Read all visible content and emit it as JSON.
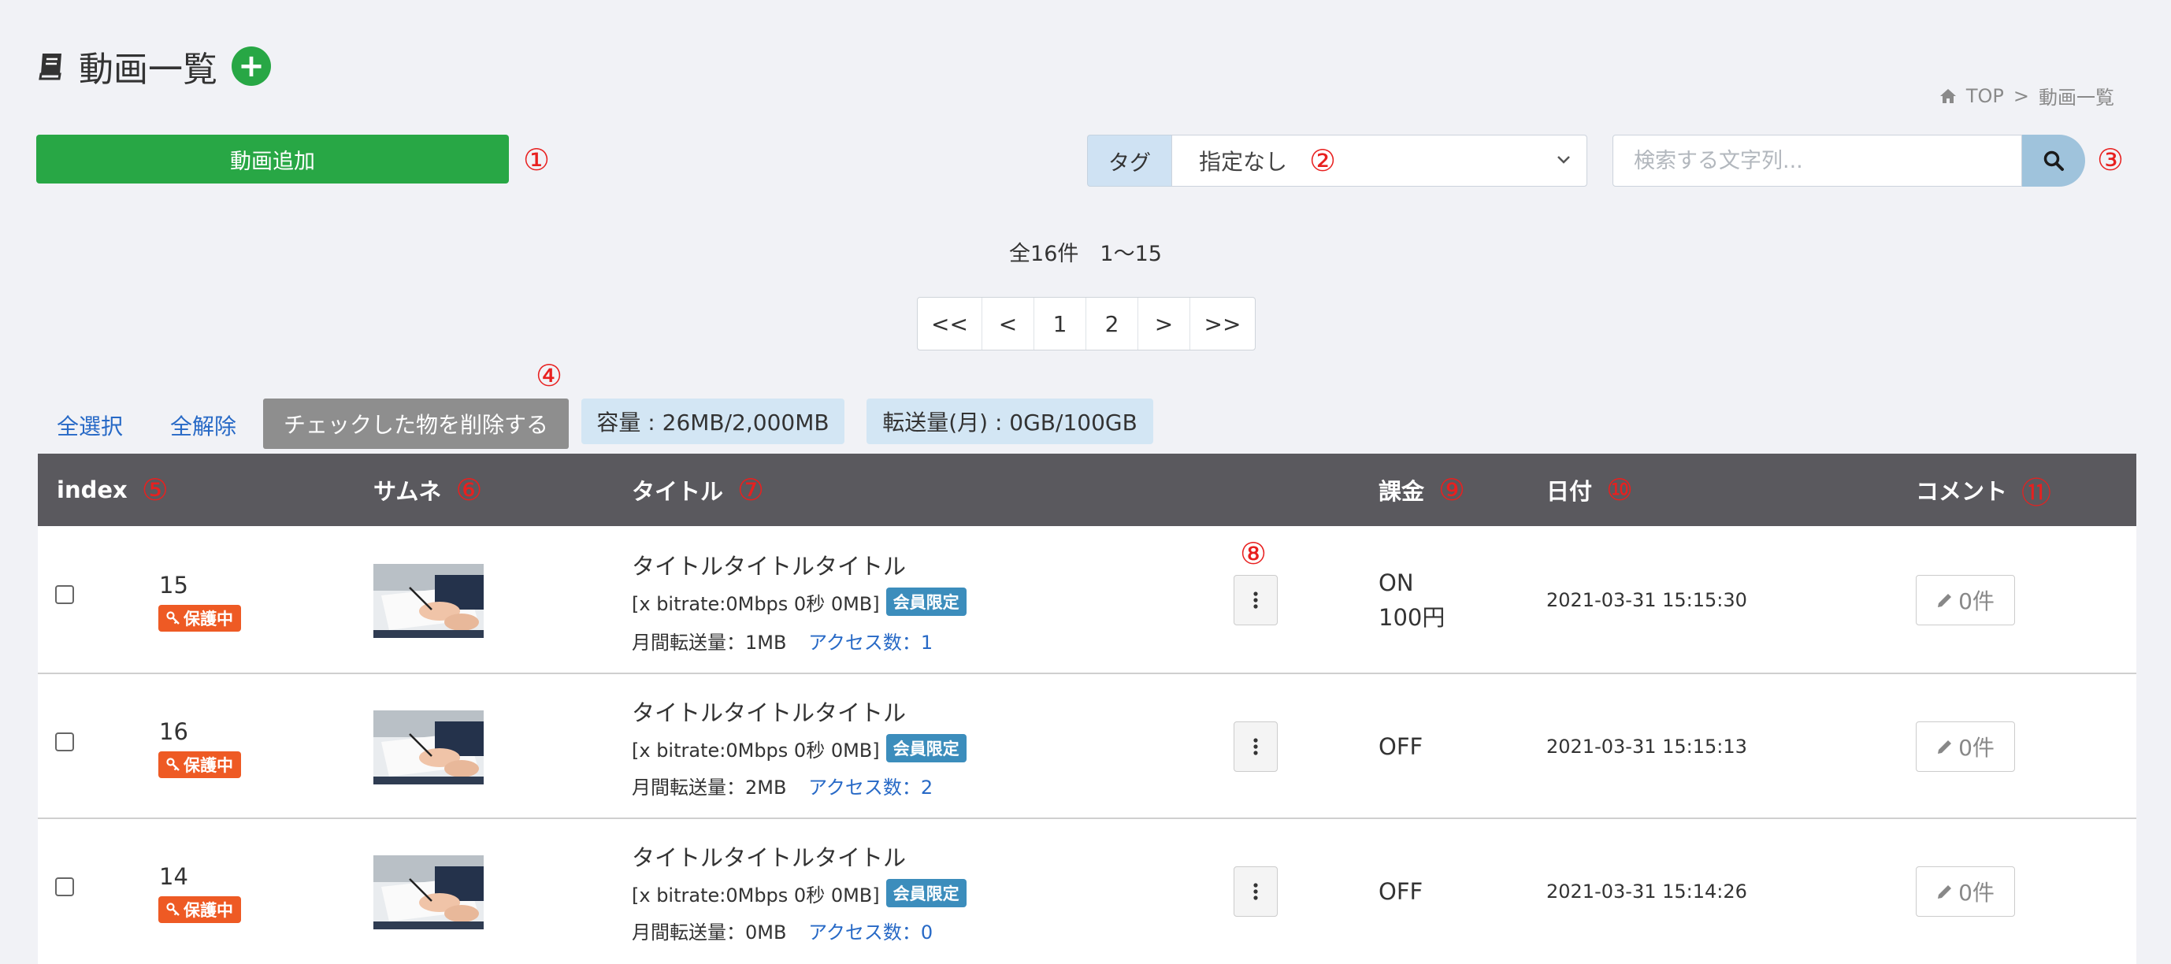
{
  "header": {
    "title": "動画一覧",
    "add_icon": "plus-circle-icon",
    "breadcrumb": {
      "home": "TOP",
      "separator": ">",
      "current": "動画一覧"
    }
  },
  "toolbar": {
    "add_video_label": "動画追加",
    "tag_label": "タグ",
    "tag_selected": "指定なし",
    "search_placeholder": "検索する文字列..."
  },
  "annotations": [
    "①",
    "②",
    "③",
    "④",
    "⑤",
    "⑥",
    "⑦",
    "⑧",
    "⑨",
    "⑩",
    "⑪"
  ],
  "pagination": {
    "summary": "全16件　1〜15",
    "items": [
      "<<",
      "<",
      "1",
      "2",
      ">",
      ">>"
    ]
  },
  "bulk": {
    "select_all": "全選択",
    "deselect_all": "全解除",
    "delete_checked": "チェックした物を削除する",
    "capacity": "容量 : 26MB/2,000MB",
    "transfer": "転送量(月) : 0GB/100GB"
  },
  "table": {
    "columns": [
      "index",
      "サムネ",
      "タイトル",
      "課金",
      "日付",
      "コメント"
    ],
    "rows": [
      {
        "index": "15",
        "badge": "保護中",
        "title": "タイトルタイトルタイトル",
        "bitrate": "[x bitrate:0Mbps 0秒 0MB]",
        "member_badge": "会員限定",
        "transfer": "月間転送量：1MB",
        "access": "アクセス数：1",
        "charge": "ON",
        "price": "100円",
        "date": "2021-03-31 15:15:30",
        "comments": "0件"
      },
      {
        "index": "16",
        "badge": "保護中",
        "title": "タイトルタイトルタイトル",
        "bitrate": "[x bitrate:0Mbps 0秒 0MB]",
        "member_badge": "会員限定",
        "transfer": "月間転送量：2MB",
        "access": "アクセス数：2",
        "charge": "OFF",
        "price": "",
        "date": "2021-03-31 15:15:13",
        "comments": "0件"
      },
      {
        "index": "14",
        "badge": "保護中",
        "title": "タイトルタイトルタイトル",
        "bitrate": "[x bitrate:0Mbps 0秒 0MB]",
        "member_badge": "会員限定",
        "transfer": "月間転送量：0MB",
        "access": "アクセス数：0",
        "charge": "OFF",
        "price": "",
        "date": "2021-03-31 15:14:26",
        "comments": "0件"
      }
    ]
  },
  "colors": {
    "primary_green": "#28a745",
    "header_dark": "#5a595e",
    "annotation_red": "#e8201f",
    "protect_orange": "#ee5a24",
    "member_blue": "#3c8dbc",
    "link_blue": "#2769c6"
  }
}
